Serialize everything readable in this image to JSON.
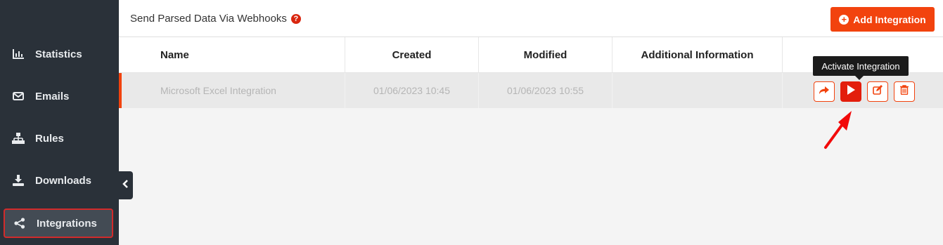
{
  "sidebar": {
    "items": [
      {
        "label": "Statistics",
        "icon": "bar-chart-icon"
      },
      {
        "label": "Emails",
        "icon": "envelope-icon"
      },
      {
        "label": "Rules",
        "icon": "sitemap-icon"
      },
      {
        "label": "Downloads",
        "icon": "download-icon"
      },
      {
        "label": "Integrations",
        "icon": "share-icon",
        "active": true
      }
    ]
  },
  "header": {
    "title": "Send Parsed Data Via Webhooks",
    "help": "?",
    "add_button": "Add Integration"
  },
  "table": {
    "columns": [
      "Name",
      "Created",
      "Modified",
      "Additional Information",
      ""
    ],
    "rows": [
      {
        "name": "Microsoft Excel Integration",
        "created": "01/06/2023 10:45",
        "modified": "01/06/2023 10:55",
        "additional": ""
      }
    ]
  },
  "tooltip": "Activate Integration",
  "colors": {
    "accent": "#f2430e",
    "sidebar": "#2a3139",
    "active_outline": "#d22b2b"
  }
}
